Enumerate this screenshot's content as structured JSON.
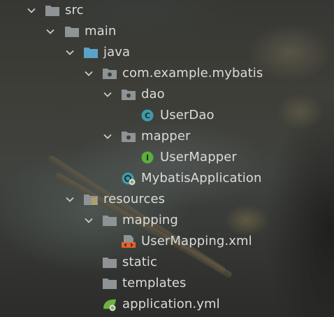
{
  "project_tree": {
    "nodes": [
      {
        "label": "src",
        "icon": "folder-icon",
        "expanded": true
      },
      {
        "label": "main",
        "icon": "folder-icon",
        "expanded": true
      },
      {
        "label": "java",
        "icon": "source-root-folder-icon",
        "expanded": true
      },
      {
        "label": "com.example.mybatis",
        "icon": "package-icon",
        "expanded": true
      },
      {
        "label": "dao",
        "icon": "package-icon",
        "expanded": true
      },
      {
        "label": "UserDao",
        "icon": "class-icon",
        "badge": "C"
      },
      {
        "label": "mapper",
        "icon": "package-icon",
        "expanded": true
      },
      {
        "label": "UserMapper",
        "icon": "interface-icon",
        "badge": "I"
      },
      {
        "label": "MybatisApplication",
        "icon": "spring-boot-class-icon"
      },
      {
        "label": "resources",
        "icon": "resources-root-folder-icon",
        "expanded": true
      },
      {
        "label": "mapping",
        "icon": "folder-icon",
        "expanded": true
      },
      {
        "label": "UserMapping.xml",
        "icon": "xml-file-icon"
      },
      {
        "label": "static",
        "icon": "folder-icon"
      },
      {
        "label": "templates",
        "icon": "folder-icon"
      },
      {
        "label": "application.yml",
        "icon": "spring-yaml-file-icon"
      }
    ]
  },
  "colors": {
    "text": "#d9dcdc",
    "folder": "#8e9496",
    "source_root": "#5aa3c8",
    "class_badge": "#3f9aaa",
    "interface_badge": "#5cae3c",
    "xml_icon": "#e4632c",
    "spring_green": "#6db33f"
  }
}
